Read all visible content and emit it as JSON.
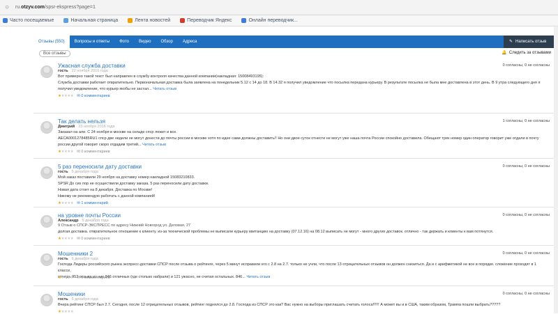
{
  "browser": {
    "url_prefix": "ru.",
    "url_host": "otzyv.com",
    "url_path": "/spsr-ekspress?page=1"
  },
  "bookmarks": [
    {
      "label": "Часто посещаемые",
      "color": "#3b7dd8"
    },
    {
      "label": "Начальная страница",
      "color": "#5aa0e0"
    },
    {
      "label": "Лента новостей",
      "color": "#f0a000"
    },
    {
      "label": "Переводчик Яндекс",
      "color": "#d23c2c"
    },
    {
      "label": "Онлайн переводчик...",
      "color": "#3b7dd8"
    }
  ],
  "tabs": [
    {
      "label": "Отзывы (550)",
      "active": true
    },
    {
      "label": "Вопросы и ответы"
    },
    {
      "label": "Фото"
    },
    {
      "label": "Видео"
    },
    {
      "label": "Обзор"
    },
    {
      "label": "Адреса"
    }
  ],
  "write_review": "Написать отзыв",
  "all_reviews": "Все отзывы",
  "follow_reviews": "Следить за отзывами",
  "reviews": [
    {
      "title": "Ужасная служба доставки",
      "author": "гость",
      "date": "22 ноября 2016 года",
      "votes": "0 согласны, 0 не согласны",
      "location": "",
      "body": [
        "Вот примерно такой текст был направлен в службу контроля качества данной компании(накладная: 15008493195):",
        "Служба доставки работает отвратительно. Первоначальная доставка была заявлена на понедельник 5.12 с 14 до 18. В 14.32 я получил уведомление что посылка передана курьеру. В результате посылка не была мне доставлена в этот день. В 9 утра следующего дня я",
        "получил уведомление, что курьер якобы не застал..."
      ],
      "more": "Читать отзыв",
      "stars": 1,
      "comments": "0 комментариев",
      "comments_link": true
    },
    {
      "title": "Так делать нельзя",
      "author": "Дмитрий",
      "date": "23 ноября 2016 года",
      "votes": "1 согласны, 0 не согласны",
      "location": "",
      "body": [
        "Заказал на али. С 24 ноября в москве на складе спср лежит и все.",
        "AECA0001278485RU1 спср две недели не могут донести до почты россии в москве хотя по идее сами должны доставить!! Но они двое суток отнести не могут уже наша почта России спокойно доставила. Обещают трек номер один оператор говорит уже отдали в почту",
        "россии другой говорит скоро отдадим третий..."
      ],
      "more": "Читать отзыв",
      "stars": 1,
      "comments": "0 комментариев",
      "comments_link": false
    },
    {
      "title": "5 раз переносили дату доставки",
      "author": "гость",
      "date": "5 декабря года",
      "votes": "0 согласны, 0 не согласны",
      "location": "",
      "body": [
        "Мой заказ поставили 29 ноября на доставку номер накладной 15083210833.",
        "SPSR До сих пор не осуществили доставку заказа. 5 раз переносили дату доставки.",
        "Новая дата стоит на 8 декабря. Доставка по Москве!",
        "Никому не рекомендую работать с данной компанией!"
      ],
      "more": "",
      "stars": 1,
      "comments": "1 комментарий",
      "comments_link": true
    },
    {
      "title": "на уровне почты России",
      "author": "Александр",
      "date": "5 декабря года",
      "votes": "0 согласны, 0 не согласны",
      "location": "9 Отзыв о СПСР-ЭКСПРЕСС по адресу Нижний Новгород ул. Деловая, 27",
      "body": [
        "долгая доставка. отвратительное отношение к клиенту. из-за технической проблемы не выписали курьеру квитанцию на доставку (07.12.16) на 08.12 выписать не могут - много других доставок. отлично - так держать и клиенты к вам потянутся."
      ],
      "more": "",
      "stars": 1,
      "comments": "0 комментариев",
      "comments_link": false
    },
    {
      "title": "Мошенники 2",
      "author": "гость",
      "date": "6 декабря года",
      "votes": "0 согласны, 0 не согласны",
      "location": "",
      "body": [
        "Господа Лидеры российского рынка экспресс-доставки СПСР после отзыва о рейтинге, через 5 минут исправили его с 2.8 на 2.7. только не учли, что после 13 отрицательных отзывов он должен снизиться. Да и с арифметикой не все в порядке. сложение проходят в 1 классе,",
        "отнюдь 953 отзыва из них 846 отличных (где столько набрали) и 121 ужасно, не считая остальных. 846..."
      ],
      "more": "Читать отзыв",
      "stars": 1,
      "comments": "0 комментариев",
      "comments_link": false
    },
    {
      "title": "Мошеники",
      "author": "гость",
      "date": "6 декабря года",
      "votes": "0 согласны, 0 не согласны",
      "location": "",
      "body": [
        "Вчера рейтинг СПСР был 2.7. Сегодня, после 12 отрицательных отзывов, рейтинг поднялся до 2.8. Господа из СПСР это как? Вас нужно на выборы приглашать считать голоса!!!!!! А может вы и в США, таким образом, Трампа пошли выбрать?????"
      ],
      "more": "",
      "stars": 1,
      "comments": "",
      "comments_link": false
    }
  ],
  "colors": {
    "brand": "#1e6fbf",
    "link": "#2a77c2",
    "dark_button": "#2c3e50",
    "star": "#e8a400"
  }
}
